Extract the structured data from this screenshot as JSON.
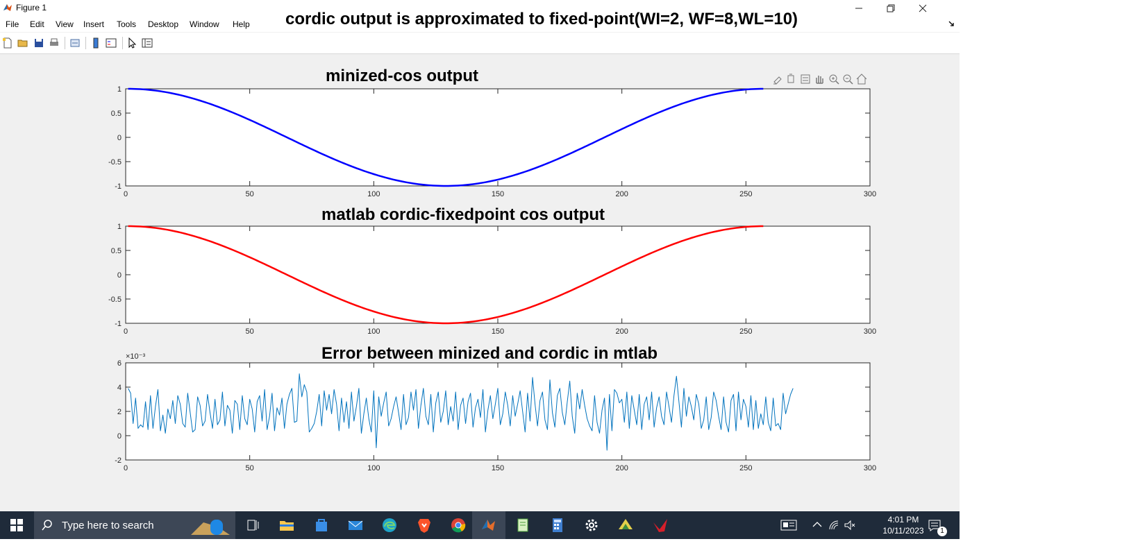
{
  "window": {
    "title": "Figure 1",
    "menu": [
      "File",
      "Edit",
      "View",
      "Insert",
      "Tools",
      "Desktop",
      "Window",
      "Help"
    ],
    "figure_title": "cordic output is approximated to fixed-point(WI=2, WF=8,WL=10)"
  },
  "toolbar_icons": [
    "new-figure-icon",
    "open-file-icon",
    "save-icon",
    "print-icon",
    "link-plot-icon",
    "insert-colorbar-icon",
    "insert-legend-icon",
    "edit-plot-icon",
    "property-inspector-icon"
  ],
  "axes_toolbar_icons": [
    "brush-icon",
    "data-tips-icon",
    "restore-view-icon",
    "pan-icon",
    "zoom-in-icon",
    "zoom-out-icon",
    "home-icon"
  ],
  "taskbar": {
    "search_placeholder": "Type here to search",
    "time": "4:01 PM",
    "date": "10/11/2023",
    "notification_count": "1"
  },
  "chart_data": [
    {
      "type": "line",
      "title": "minized-cos output",
      "xlabel": "",
      "ylabel": "",
      "xlim": [
        0,
        300
      ],
      "ylim": [
        -1,
        1
      ],
      "xticks": [
        0,
        50,
        100,
        150,
        200,
        250,
        300
      ],
      "yticks": [
        -1,
        -0.5,
        0,
        0.5,
        1
      ],
      "xtick_labels": [
        "0",
        "50",
        "100",
        "150",
        "200",
        "250",
        "300"
      ],
      "ytick_labels": [
        "-1",
        "-0.5",
        "0",
        "0.5",
        "1"
      ],
      "exponent_label": "",
      "grid": false,
      "series": [
        {
          "color": "#0000ff",
          "width": 2.5,
          "function": "cos(2*pi*(n-1)/256)",
          "n_range": [
            1,
            257
          ]
        }
      ]
    },
    {
      "type": "line",
      "title": "matlab cordic-fixedpoint cos output",
      "xlabel": "",
      "ylabel": "",
      "xlim": [
        0,
        300
      ],
      "ylim": [
        -1,
        1
      ],
      "xticks": [
        0,
        50,
        100,
        150,
        200,
        250,
        300
      ],
      "yticks": [
        -1,
        -0.5,
        0,
        0.5,
        1
      ],
      "xtick_labels": [
        "0",
        "50",
        "100",
        "150",
        "200",
        "250",
        "300"
      ],
      "ytick_labels": [
        "-1",
        "-0.5",
        "0",
        "0.5",
        "1"
      ],
      "exponent_label": "",
      "grid": false,
      "series": [
        {
          "color": "#ff0000",
          "width": 2.5,
          "function": "cos(2*pi*(n-1)/256)",
          "n_range": [
            1,
            257
          ]
        }
      ]
    },
    {
      "type": "line",
      "title": "Error between minized and cordic in mtlab",
      "xlabel": "",
      "ylabel": "",
      "xlim": [
        0,
        300
      ],
      "ylim": [
        -2,
        6
      ],
      "xticks": [
        0,
        50,
        100,
        150,
        200,
        250,
        300
      ],
      "yticks": [
        -2,
        0,
        2,
        4,
        6
      ],
      "xtick_labels": [
        "0",
        "50",
        "100",
        "150",
        "200",
        "250",
        "300"
      ],
      "ytick_labels": [
        "-2",
        "0",
        "2",
        "4",
        "6"
      ],
      "exponent_label": "×10⁻³",
      "grid": false,
      "series": [
        {
          "color": "#0072bd",
          "width": 1,
          "x_start": 1,
          "values": [
            3.9,
            3.5,
            1.0,
            3.1,
            0.6,
            0.9,
            0.7,
            2.8,
            0.5,
            3.3,
            0.6,
            2.4,
            3.8,
            0.4,
            1.7,
            0.2,
            2.2,
            1.4,
            2.9,
            1.0,
            3.3,
            2.6,
            1.0,
            0.7,
            3.5,
            1.9,
            0.3,
            0.5,
            3.2,
            2.5,
            0.8,
            1.2,
            3.4,
            1.9,
            0.6,
            3.0,
            0.9,
            1.3,
            3.6,
            0.8,
            2.5,
            2.1,
            0.2,
            2.9,
            2.6,
            0.5,
            3.3,
            1.4,
            0.9,
            3.0,
            2.2,
            0.3,
            2.8,
            3.3,
            1.2,
            3.8,
            0.5,
            1.6,
            3.5,
            0.4,
            2.3,
            1.7,
            3.1,
            0.6,
            2.6,
            3.4,
            3.9,
            1.1,
            1.2,
            5.1,
            3.2,
            4.2,
            3.6,
            0.3,
            0.6,
            1.0,
            2.0,
            3.4,
            0.8,
            3.7,
            2.1,
            3.4,
            1.8,
            3.8,
            2.6,
            0.4,
            3.1,
            1.1,
            2.8,
            0.6,
            3.6,
            1.2,
            2.4,
            3.9,
            0.2,
            1.8,
            3.1,
            1.4,
            0.3,
            3.7,
            -1.0,
            3.2,
            1.6,
            2.7,
            3.6,
            0.8,
            1.4,
            2.4,
            3.2,
            1.9,
            0.5,
            3.4,
            0.9,
            1.5,
            3.6,
            2.1,
            3.8,
            0.6,
            2.5,
            3.9,
            1.6,
            0.9,
            3.4,
            0.3,
            2.7,
            3.6,
            1.1,
            2.0,
            3.7,
            0.9,
            2.4,
            1.2,
            3.6,
            0.5,
            2.5,
            3.1,
            1.0,
            2.8,
            3.5,
            0.7,
            2.3,
            3.0,
            1.5,
            3.8,
            0.3,
            2.1,
            3.3,
            1.4,
            2.6,
            3.9,
            0.9,
            1.8,
            3.6,
            2.5,
            0.8,
            3.3,
            1.6,
            2.6,
            3.7,
            2.0,
            0.3,
            3.5,
            1.2,
            4.8,
            2.6,
            0.8,
            2.9,
            3.6,
            1.3,
            0.5,
            4.6,
            1.9,
            0.7,
            3.3,
            3.9,
            1.9,
            0.9,
            2.8,
            4.5,
            1.6,
            0.2,
            3.5,
            2.2,
            3.8,
            2.5,
            1.4,
            0.8,
            0.4,
            3.3,
            1.1,
            0.2,
            2.1,
            3.1,
            -1.2,
            3.4,
            0.4,
            3.8,
            3.5,
            2.7,
            3.0,
            1.1,
            3.6,
            0.6,
            3.3,
            2.1,
            0.9,
            3.4,
            0.5,
            2.6,
            3.2,
            1.3,
            3.6,
            0.7,
            2.3,
            3.2,
            1.6,
            0.9,
            3.6,
            2.4,
            1.1,
            3.3,
            4.9,
            2.8,
            0.7,
            3.9,
            1.6,
            3.2,
            2.4,
            1.3,
            3.4,
            2.6,
            0.6,
            1.3,
            3.2,
            0.5,
            1.5,
            3.6,
            2.9,
            1.6,
            0.5,
            3.2,
            1.1,
            0.3,
            2.9,
            3.4,
            0.4,
            3.6,
            1.3,
            3.0,
            2.4,
            0.7,
            3.3,
            0.5,
            2.9,
            0.6,
            1.8,
            0.9,
            3.2,
            1.1,
            0.4,
            3.1,
            0.8,
            1.0,
            0.5,
            3.5,
            1.8,
            2.6,
            3.4,
            3.9
          ]
        }
      ]
    }
  ]
}
